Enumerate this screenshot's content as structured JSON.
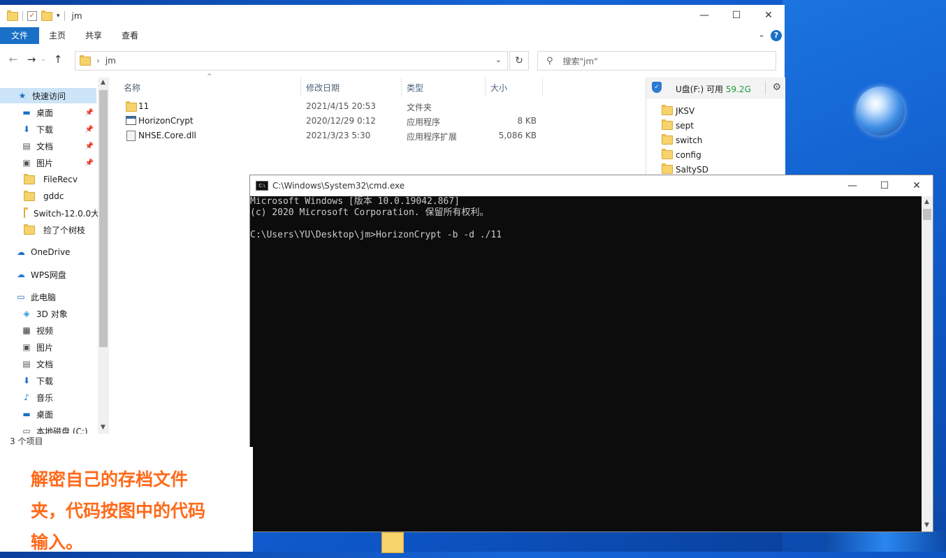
{
  "explorer": {
    "title": "jm",
    "ribbon_tabs": [
      "文件",
      "主页",
      "共享",
      "查看"
    ],
    "address": {
      "crumb": "jm"
    },
    "search": {
      "placeholder": "搜索\"jm\""
    },
    "nav": {
      "quick_access": "快速访问",
      "quick_items": [
        "桌面",
        "下载",
        "文档",
        "图片",
        "FileRecv",
        "gddc",
        "Switch-12.0.0大",
        "捡了个树枝"
      ],
      "onedrive": "OneDrive",
      "wps": "WPS网盘",
      "this_pc": "此电脑",
      "pc_items": [
        "3D 对象",
        "视频",
        "图片",
        "文档",
        "下载",
        "音乐",
        "桌面",
        "本地磁盘 (C:)"
      ]
    },
    "columns": {
      "name": "名称",
      "date": "修改日期",
      "type": "类型",
      "size": "大小"
    },
    "files": [
      {
        "name": "11",
        "date": "2021/4/15 20:53",
        "type": "文件夹",
        "size": "",
        "icon": "folder-icon"
      },
      {
        "name": "HorizonCrypt",
        "date": "2020/12/29 0:12",
        "type": "应用程序",
        "size": "8 KB",
        "icon": "application-icon"
      },
      {
        "name": "NHSE.Core.dll",
        "date": "2021/3/23 5:30",
        "type": "应用程序扩展",
        "size": "5,086 KB",
        "icon": "dll-icon"
      }
    ],
    "status": "3 个项目"
  },
  "usb_panel": {
    "label": "U盘(F:)",
    "free_label": "可用",
    "free_value": "59.2G",
    "free_color": "#1c9b3a",
    "folders": [
      "JKSV",
      "sept",
      "switch",
      "config",
      "SaltySD"
    ]
  },
  "cmd": {
    "title": "C:\\Windows\\System32\\cmd.exe",
    "lines": [
      "Microsoft Windows [版本 10.0.19042.867]",
      "(c) 2020 Microsoft Corporation. 保留所有权利。",
      "",
      "C:\\Users\\YU\\Desktop\\jm>HorizonCrypt -b -d ./11"
    ]
  },
  "annotation": {
    "text": "解密自己的存档文件夹，代码按图中的代码输入。",
    "color": "#ff6a1a"
  },
  "colors": {
    "accent": "#1a6fc7",
    "selection": "#cce4f7",
    "console_bg": "#0c0c0c"
  }
}
